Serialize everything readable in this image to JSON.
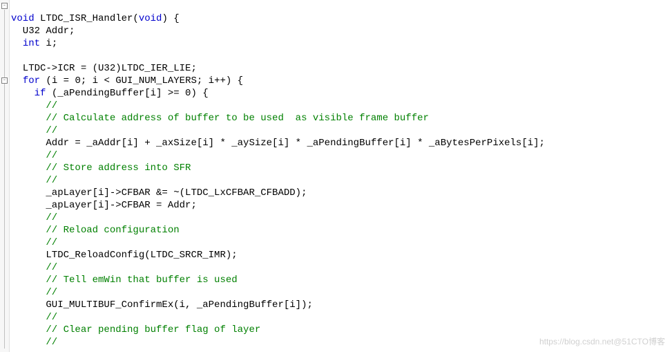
{
  "code": {
    "l1_a": "void",
    "l1_b": " LTDC_ISR_Handler(",
    "l1_c": "void",
    "l1_d": ") {",
    "l2": "  U32 Addr;",
    "l3_a": "  ",
    "l3_b": "int",
    "l3_c": " i;",
    "l4": "",
    "l5": "  LTDC->ICR = (U32)LTDC_IER_LIE;",
    "l6_a": "  ",
    "l6_b": "for",
    "l6_c": " (i = 0; i < GUI_NUM_LAYERS; i++) {",
    "l7_a": "    ",
    "l7_b": "if",
    "l7_c": " (_aPendingBuffer[i] >= 0) {",
    "l8": "      //",
    "l9": "      // Calculate address of buffer to be used  as visible frame buffer",
    "l10": "      //",
    "l11": "      Addr = _aAddr[i] + _axSize[i] * _aySize[i] * _aPendingBuffer[i] * _aBytesPerPixels[i];",
    "l12": "      //",
    "l13": "      // Store address into SFR",
    "l14": "      //",
    "l15": "      _apLayer[i]->CFBAR &= ~(LTDC_LxCFBAR_CFBADD);",
    "l16": "      _apLayer[i]->CFBAR = Addr;",
    "l17": "      //",
    "l18": "      // Reload configuration",
    "l19": "      //",
    "l20": "      LTDC_ReloadConfig(LTDC_SRCR_IMR);",
    "l21": "      //",
    "l22": "      // Tell emWin that buffer is used",
    "l23": "      //",
    "l24": "      GUI_MULTIBUF_ConfirmEx(i, _aPendingBuffer[i]);",
    "l25": "      //",
    "l26": "      // Clear pending buffer flag of layer",
    "l27": "      //"
  },
  "watermark": "https://blog.csdn.net@51CTO博客"
}
